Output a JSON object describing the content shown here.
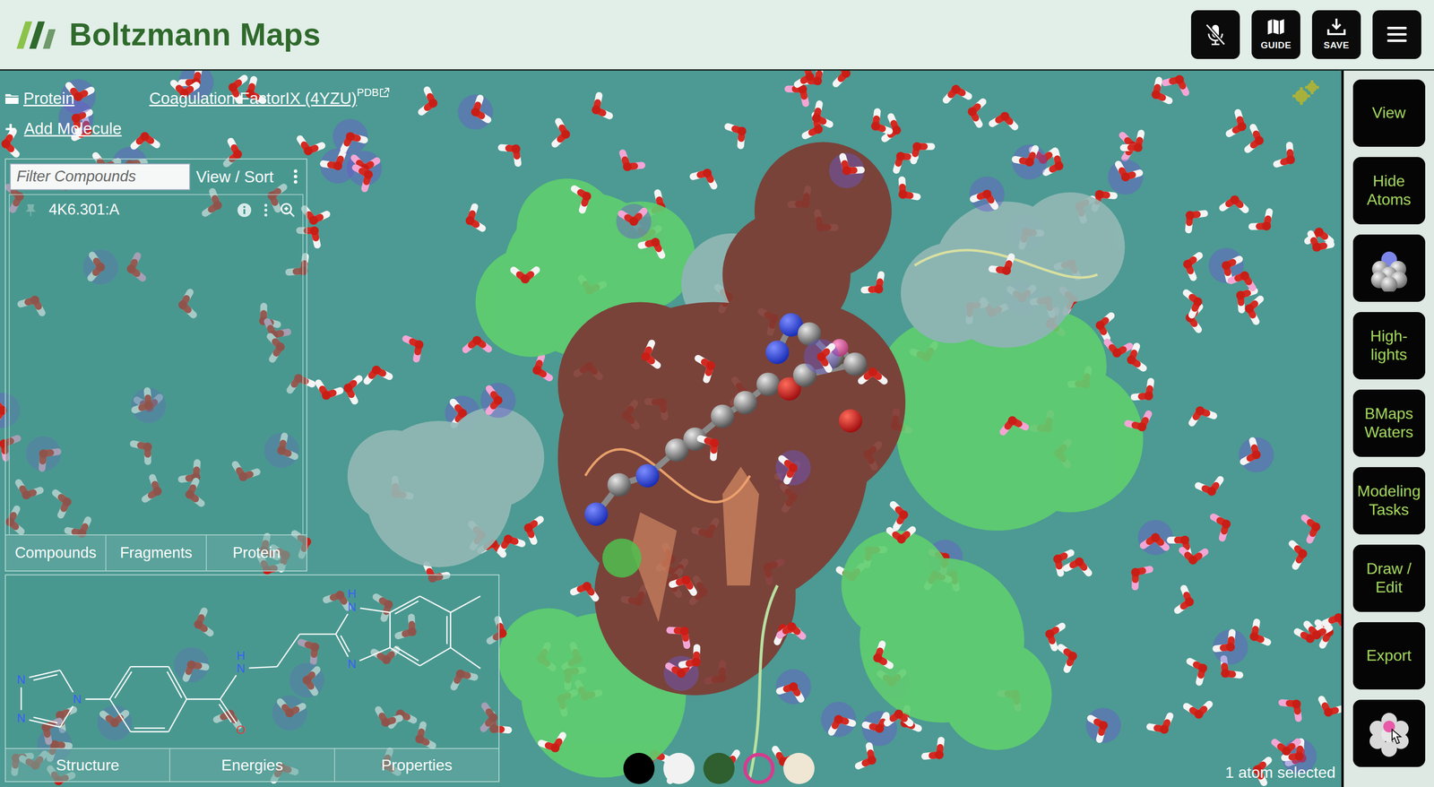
{
  "app": {
    "title": "Boltzmann Maps"
  },
  "header": {
    "buttons": [
      {
        "kind": "mute"
      },
      {
        "kind": "guide",
        "label": "GUIDE"
      },
      {
        "kind": "save",
        "label": "SAVE"
      },
      {
        "kind": "menu"
      }
    ]
  },
  "breadcrumb": {
    "protein": "Protein",
    "structure": "Coagulation FactorIX (4YZU)",
    "pdb": "PDB"
  },
  "add_molecule": {
    "symbol": "+",
    "label": "Add Molecule"
  },
  "compounds": {
    "filter_placeholder": "Filter Compounds",
    "view_sort": "View / Sort",
    "items": [
      {
        "name": "4K6.301:A"
      }
    ]
  },
  "list_tabs": [
    "Compounds",
    "Fragments",
    "Protein"
  ],
  "structure": {
    "labels": [
      "N",
      "N",
      "N",
      "H",
      "N",
      "O",
      "H",
      "N",
      "N"
    ]
  },
  "structure_tabs": [
    "Structure",
    "Energies",
    "Properties"
  ],
  "toolbar": [
    {
      "kind": "text",
      "label": "View"
    },
    {
      "kind": "text",
      "label": "Hide\nAtoms"
    },
    {
      "kind": "molecule"
    },
    {
      "kind": "text",
      "label": "High-\nlights"
    },
    {
      "kind": "text",
      "label": "BMaps\nWaters"
    },
    {
      "kind": "text",
      "label": "Modeling\nTasks"
    },
    {
      "kind": "text",
      "label": "Draw /\nEdit"
    },
    {
      "kind": "text",
      "label": "Export"
    },
    {
      "kind": "select"
    }
  ],
  "swatches": [
    {
      "color": "#000000",
      "selected": false
    },
    {
      "color": "#f2f2f2",
      "selected": false
    },
    {
      "color": "#2f5e2f",
      "selected": false
    },
    {
      "color": "#d63b8f",
      "selected": true
    },
    {
      "color": "#efe6d4",
      "selected": false
    }
  ],
  "status": "1 atom selected"
}
